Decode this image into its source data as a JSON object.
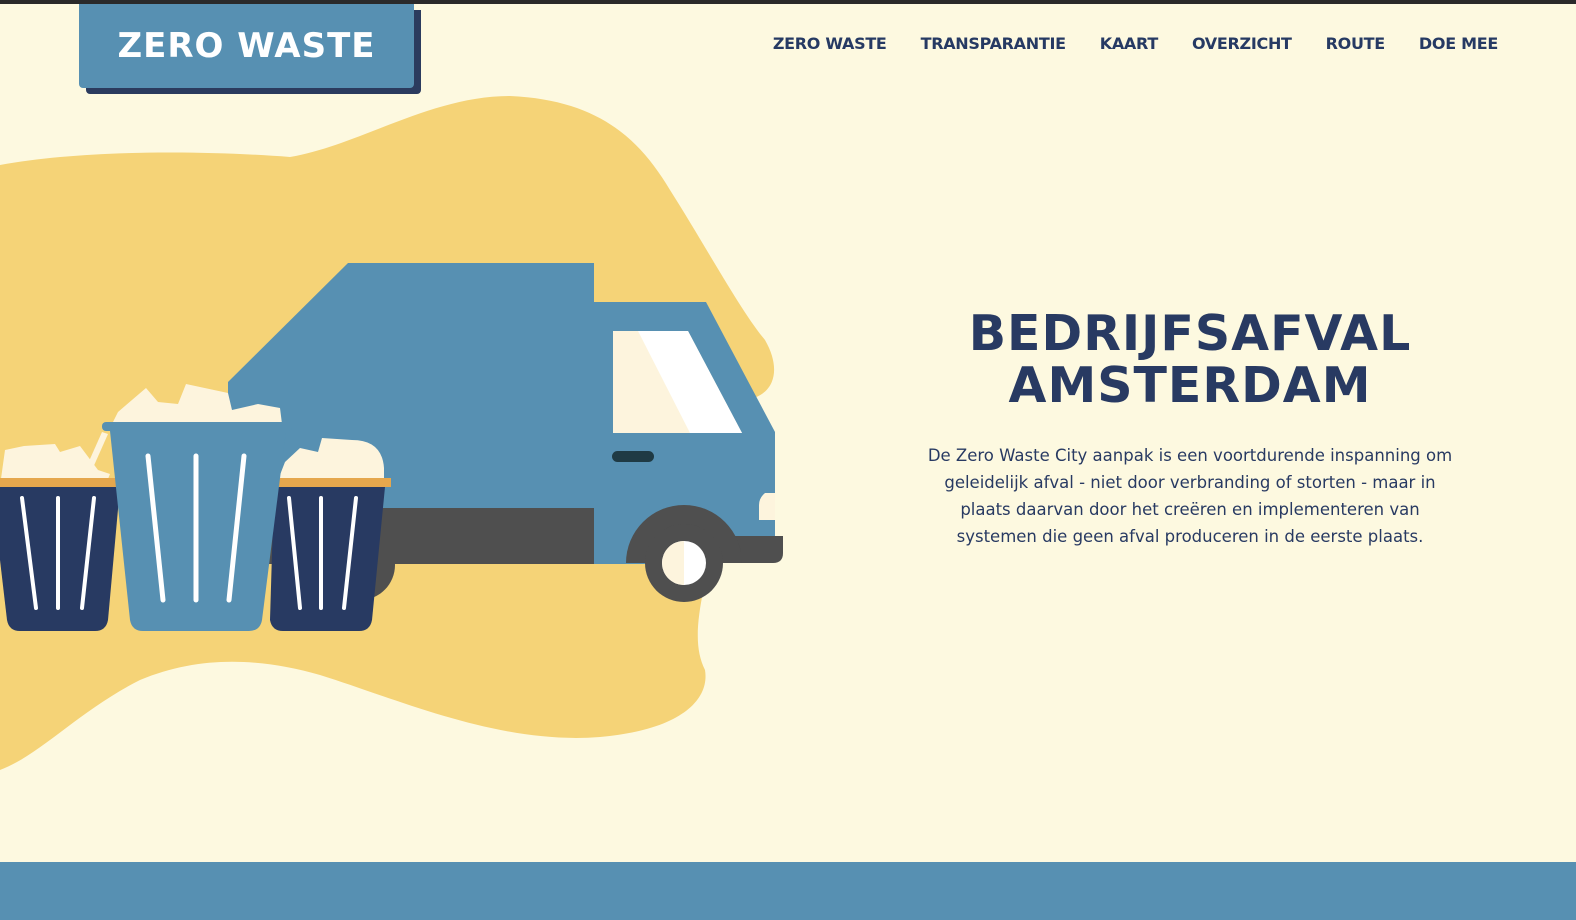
{
  "brand": {
    "logo_text": "ZERO WASTE"
  },
  "nav": {
    "items": [
      {
        "label": "ZERO WASTE"
      },
      {
        "label": "TRANSPARANTIE"
      },
      {
        "label": "KAART"
      },
      {
        "label": "OVERZICHT"
      },
      {
        "label": "ROUTE"
      },
      {
        "label": "DOE MEE"
      }
    ]
  },
  "hero": {
    "title_line1": "BEDRIJFSAFVAL",
    "title_line2": "AMSTERDAM",
    "description": "De Zero Waste City aanpak is een voortdurende inspanning om geleidelijk afval - niet door verbranding of storten - maar in plaats daarvan door het creëren en implementeren van systemen die geen afval produceren in de eerste plaats."
  },
  "colors": {
    "background": "#fdf9e0",
    "blob": "#f5d377",
    "primary_blue": "#5790b2",
    "navy": "#283a62",
    "dark_gray": "#4f4f4f"
  },
  "illustration": {
    "icons": [
      "blob-shape",
      "garbage-truck-icon",
      "trash-bin-icon"
    ]
  }
}
